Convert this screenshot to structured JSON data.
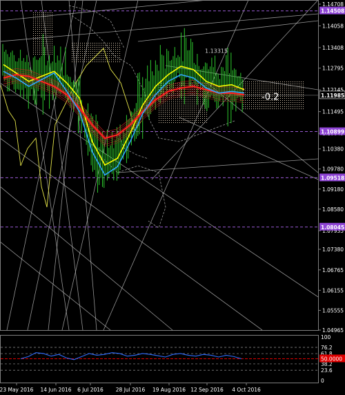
{
  "chart_data": [
    {
      "type": "candlestick",
      "x_axis": {
        "labels": [
          "23 May 2016",
          "14 Jun 2016",
          "6 Jul 2016",
          "28 Jul 2016",
          "19 Aug 2016",
          "12 Sep 2016",
          "4 Oct 2016"
        ]
      },
      "y_axis": {
        "ticks": [
          1.14708,
          1.14058,
          1.13408,
          1.12795,
          1.12145,
          1.11495,
          1.10845,
          1.1038,
          1.0978,
          1.0918,
          1.0858,
          1.07935,
          1.0738,
          1.06765,
          1.06155,
          1.05555,
          1.04965
        ],
        "ylim": [
          1.04965,
          1.14708
        ]
      },
      "level_labels": [
        {
          "value": 1.14508,
          "label": "1.14508",
          "style": "level"
        },
        {
          "value": 1.11985,
          "label": "1.11985",
          "style": "price"
        },
        {
          "value": 1.10899,
          "label": "1.10899",
          "style": "level"
        },
        {
          "value": 1.09518,
          "label": "1.09518",
          "style": "level"
        },
        {
          "value": 1.08045,
          "label": "1.08045",
          "style": "level"
        }
      ],
      "annotations": [
        {
          "text": "1.13315",
          "value": 1.13315,
          "x_label": "19 Aug 2016"
        },
        {
          "text": "-0.2",
          "value": 1.1195,
          "x_label": "4 Oct 2016"
        }
      ],
      "series": [
        {
          "name": "Fast MA",
          "values": [
            1.129,
            1.1265,
            1.124,
            1.1255,
            1.127,
            1.1235,
            1.119,
            1.106,
            1.099,
            1.101,
            1.1085,
            1.117,
            1.1225,
            1.126,
            1.1285,
            1.1275,
            1.124,
            1.1225,
            1.123,
            1.1215
          ]
        },
        {
          "name": "Slow MA",
          "values": [
            1.125,
            1.126,
            1.1255,
            1.124,
            1.1225,
            1.12,
            1.116,
            1.111,
            1.107,
            1.108,
            1.111,
            1.115,
            1.1185,
            1.121,
            1.122,
            1.1225,
            1.1215,
            1.1205,
            1.1205,
            1.12
          ]
        },
        {
          "name": "Signal MA",
          "values": [
            1.127,
            1.125,
            1.1225,
            1.1245,
            1.1265,
            1.121,
            1.115,
            1.103,
            1.096,
            1.0985,
            1.106,
            1.1145,
            1.12,
            1.124,
            1.126,
            1.125,
            1.122,
            1.1205,
            1.121,
            1.1205
          ]
        }
      ]
    },
    {
      "type": "line",
      "yticks": [
        100,
        76.2,
        61.8,
        50,
        38.2,
        23.6,
        0
      ],
      "ylim": [
        0,
        100
      ],
      "threshold": 50,
      "threshold_label": "50.0000",
      "values": [
        50,
        55,
        64,
        62,
        56,
        60,
        52,
        48,
        55,
        62,
        58,
        60,
        64,
        62,
        56,
        58,
        62,
        60,
        57,
        54,
        60,
        62,
        58,
        56,
        60,
        58,
        54,
        58,
        55,
        50
      ]
    }
  ]
}
